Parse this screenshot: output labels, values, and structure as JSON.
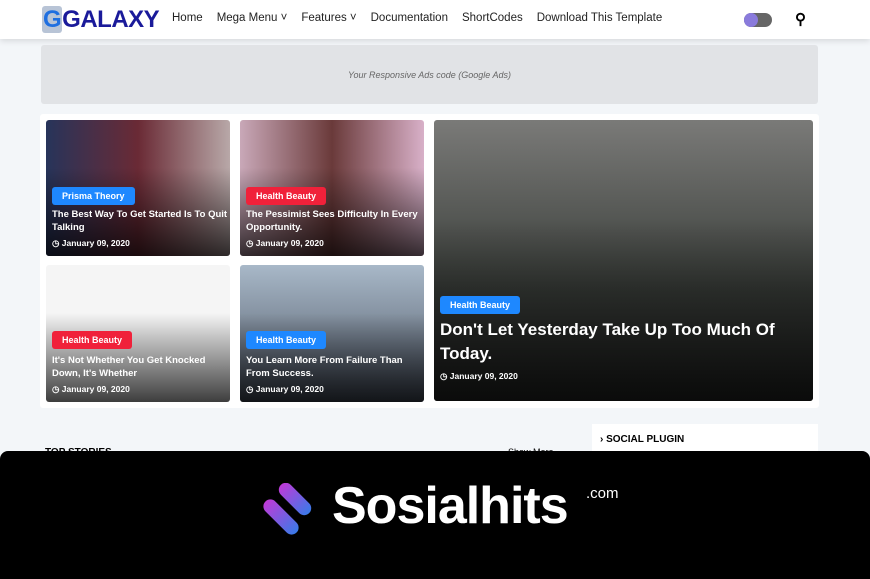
{
  "header": {
    "logo": "GALAXY",
    "logo_letter": "G",
    "nav": [
      "Home",
      "Mega Menu ˅",
      "Features ˅",
      "Documentation",
      "ShortCodes",
      "Download This Template"
    ]
  },
  "ads": "Your Responsive Ads code (Google Ads)",
  "cards": [
    {
      "badge": "Prisma Theory",
      "badge_color": "#1e88ff",
      "title": "The Best Way To Get Started Is To Quit Talking",
      "date": "January 09, 2020"
    },
    {
      "badge": "Health Beauty",
      "badge_color": "#f0213a",
      "title": "The Pessimist Sees Difficulty In Every Opportunity.",
      "date": "January 09, 2020"
    },
    {
      "badge": "Health Beauty",
      "badge_color": "#f0213a",
      "title": "It's Not Whether You Get Knocked Down, It's Whether",
      "date": "January 09, 2020"
    },
    {
      "badge": "Health Beauty",
      "badge_color": "#1e88ff",
      "title": "You Learn More From Failure Than From Success.",
      "date": "January 09, 2020"
    },
    {
      "badge": "Health Beauty",
      "badge_color": "#1e88ff",
      "title": "Don't Let Yesterday Take Up Too Much Of Today.",
      "date": "January 09, 2020"
    }
  ],
  "sections": {
    "top_stories": "TOP STORIES",
    "show_more": "Show More",
    "social": "› SOCIAL PLUGIN"
  },
  "watermark": {
    "brand": "Sosialhits",
    "suffix": ".com"
  }
}
